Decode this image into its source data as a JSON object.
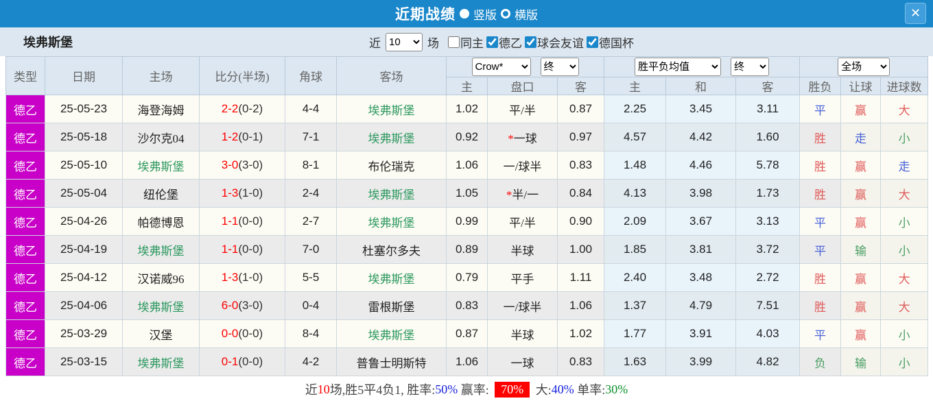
{
  "colors": {
    "accent_blue": "#1a87ca",
    "panel_bg": "#dce7f1",
    "badge_magenta": "#c800c8",
    "subject_team_green": "#2e9960",
    "score_red": "#ff0000",
    "win_red": "#e05c5c",
    "draw_blue": "#4a63d8",
    "lose_green": "#4a9e63",
    "euro_col_bg": "#e8f3fa"
  },
  "titlebar": {
    "title": "近期战绩",
    "radio_vertical": "竖版",
    "radio_horizontal": "横版",
    "close_glyph": "✕"
  },
  "filterbar": {
    "team": "埃弗斯堡",
    "near_label": "近",
    "matches_selected": "10",
    "matches_label": "场",
    "filters": [
      {
        "label": "同主",
        "checked": false
      },
      {
        "label": "德乙",
        "checked": true
      },
      {
        "label": "球会友谊",
        "checked": true
      },
      {
        "label": "德国杯",
        "checked": true
      }
    ]
  },
  "table": {
    "headers": {
      "type": "类型",
      "date": "日期",
      "home": "主场",
      "score": "比分(半场)",
      "corner": "角球",
      "away": "客场",
      "asian_select": "Crow*",
      "asian_final": "终",
      "asian_sub": [
        "主",
        "盘口",
        "客"
      ],
      "euro_select": "胜平负均值",
      "euro_final": "终",
      "euro_sub": [
        "主",
        "和",
        "客"
      ],
      "full_select": "全场",
      "result_sub": [
        "胜负",
        "让球",
        "进球数"
      ]
    },
    "rows": [
      {
        "league": "德乙",
        "date": "25-05-23",
        "home": "海登海姆",
        "home_is_subject": false,
        "score": "2-2",
        "half": "(0-2)",
        "corners": "4-4",
        "away": "埃弗斯堡",
        "away_is_subject": true,
        "asian": {
          "home": "1.02",
          "star": false,
          "handicap": "平/半",
          "away": "0.87"
        },
        "euro": {
          "home": "2.25",
          "draw": "3.45",
          "away": "3.11"
        },
        "outcome": {
          "text": "平",
          "color": "blue"
        },
        "handicap_result": {
          "text": "赢",
          "color": "red"
        },
        "goals_result": {
          "text": "大",
          "color": "red"
        }
      },
      {
        "league": "德乙",
        "date": "25-05-18",
        "home": "沙尔克04",
        "home_is_subject": false,
        "score": "1-2",
        "half": "(0-1)",
        "corners": "7-1",
        "away": "埃弗斯堡",
        "away_is_subject": true,
        "asian": {
          "home": "0.92",
          "star": true,
          "handicap": "一球",
          "away": "0.97"
        },
        "euro": {
          "home": "4.57",
          "draw": "4.42",
          "away": "1.60"
        },
        "outcome": {
          "text": "胜",
          "color": "red"
        },
        "handicap_result": {
          "text": "走",
          "color": "blue"
        },
        "goals_result": {
          "text": "小",
          "color": "green"
        }
      },
      {
        "league": "德乙",
        "date": "25-05-10",
        "home": "埃弗斯堡",
        "home_is_subject": true,
        "score": "3-0",
        "half": "(3-0)",
        "corners": "8-1",
        "away": "布伦瑞克",
        "away_is_subject": false,
        "asian": {
          "home": "1.06",
          "star": false,
          "handicap": "一/球半",
          "away": "0.83"
        },
        "euro": {
          "home": "1.48",
          "draw": "4.46",
          "away": "5.78"
        },
        "outcome": {
          "text": "胜",
          "color": "red"
        },
        "handicap_result": {
          "text": "赢",
          "color": "red"
        },
        "goals_result": {
          "text": "走",
          "color": "blue"
        }
      },
      {
        "league": "德乙",
        "date": "25-05-04",
        "home": "纽伦堡",
        "home_is_subject": false,
        "score": "1-3",
        "half": "(1-0)",
        "corners": "2-4",
        "away": "埃弗斯堡",
        "away_is_subject": true,
        "asian": {
          "home": "1.05",
          "star": true,
          "handicap": "半/一",
          "away": "0.84"
        },
        "euro": {
          "home": "4.13",
          "draw": "3.98",
          "away": "1.73"
        },
        "outcome": {
          "text": "胜",
          "color": "red"
        },
        "handicap_result": {
          "text": "赢",
          "color": "red"
        },
        "goals_result": {
          "text": "大",
          "color": "red"
        }
      },
      {
        "league": "德乙",
        "date": "25-04-26",
        "home": "帕德博恩",
        "home_is_subject": false,
        "score": "1-1",
        "half": "(0-0)",
        "corners": "2-7",
        "away": "埃弗斯堡",
        "away_is_subject": true,
        "asian": {
          "home": "0.99",
          "star": false,
          "handicap": "平/半",
          "away": "0.90"
        },
        "euro": {
          "home": "2.09",
          "draw": "3.67",
          "away": "3.13"
        },
        "outcome": {
          "text": "平",
          "color": "blue"
        },
        "handicap_result": {
          "text": "赢",
          "color": "red"
        },
        "goals_result": {
          "text": "小",
          "color": "green"
        }
      },
      {
        "league": "德乙",
        "date": "25-04-19",
        "home": "埃弗斯堡",
        "home_is_subject": true,
        "score": "1-1",
        "half": "(0-0)",
        "corners": "7-0",
        "away": "杜塞尔多夫",
        "away_is_subject": false,
        "asian": {
          "home": "0.89",
          "star": false,
          "handicap": "半球",
          "away": "1.00"
        },
        "euro": {
          "home": "1.85",
          "draw": "3.81",
          "away": "3.72"
        },
        "outcome": {
          "text": "平",
          "color": "blue"
        },
        "handicap_result": {
          "text": "输",
          "color": "green"
        },
        "goals_result": {
          "text": "小",
          "color": "green"
        }
      },
      {
        "league": "德乙",
        "date": "25-04-12",
        "home": "汉诺威96",
        "home_is_subject": false,
        "score": "1-3",
        "half": "(1-0)",
        "corners": "5-5",
        "away": "埃弗斯堡",
        "away_is_subject": true,
        "asian": {
          "home": "0.79",
          "star": false,
          "handicap": "平手",
          "away": "1.11"
        },
        "euro": {
          "home": "2.40",
          "draw": "3.48",
          "away": "2.72"
        },
        "outcome": {
          "text": "胜",
          "color": "red"
        },
        "handicap_result": {
          "text": "赢",
          "color": "red"
        },
        "goals_result": {
          "text": "大",
          "color": "red"
        }
      },
      {
        "league": "德乙",
        "date": "25-04-06",
        "home": "埃弗斯堡",
        "home_is_subject": true,
        "score": "6-0",
        "half": "(3-0)",
        "corners": "0-4",
        "away": "雷根斯堡",
        "away_is_subject": false,
        "asian": {
          "home": "0.83",
          "star": false,
          "handicap": "一/球半",
          "away": "1.06"
        },
        "euro": {
          "home": "1.37",
          "draw": "4.79",
          "away": "7.51"
        },
        "outcome": {
          "text": "胜",
          "color": "red"
        },
        "handicap_result": {
          "text": "赢",
          "color": "red"
        },
        "goals_result": {
          "text": "大",
          "color": "red"
        }
      },
      {
        "league": "德乙",
        "date": "25-03-29",
        "home": "汉堡",
        "home_is_subject": false,
        "score": "0-0",
        "half": "(0-0)",
        "corners": "8-4",
        "away": "埃弗斯堡",
        "away_is_subject": true,
        "asian": {
          "home": "0.87",
          "star": false,
          "handicap": "半球",
          "away": "1.02"
        },
        "euro": {
          "home": "1.77",
          "draw": "3.91",
          "away": "4.03"
        },
        "outcome": {
          "text": "平",
          "color": "blue"
        },
        "handicap_result": {
          "text": "赢",
          "color": "red"
        },
        "goals_result": {
          "text": "小",
          "color": "green"
        }
      },
      {
        "league": "德乙",
        "date": "25-03-15",
        "home": "埃弗斯堡",
        "home_is_subject": true,
        "score": "0-1",
        "half": "(0-0)",
        "corners": "4-2",
        "away": "普鲁士明斯特",
        "away_is_subject": false,
        "asian": {
          "home": "1.06",
          "star": false,
          "handicap": "一球",
          "away": "0.83"
        },
        "euro": {
          "home": "1.63",
          "draw": "3.99",
          "away": "4.82"
        },
        "outcome": {
          "text": "负",
          "color": "green"
        },
        "handicap_result": {
          "text": "输",
          "color": "green"
        },
        "goals_result": {
          "text": "小",
          "color": "green"
        }
      }
    ]
  },
  "summary": {
    "segments": [
      {
        "text": "近",
        "style": "black"
      },
      {
        "text": "10",
        "style": "red"
      },
      {
        "text": "场,胜5平4负1, 胜率:",
        "style": "black"
      },
      {
        "text": "50%",
        "style": "blue"
      },
      {
        "text": " 赢率: ",
        "style": "black"
      },
      {
        "text": "70%",
        "style": "redbox"
      },
      {
        "text": " 大:",
        "style": "black"
      },
      {
        "text": "40%",
        "style": "blue"
      },
      {
        "text": " 单率:",
        "style": "black"
      },
      {
        "text": "30%",
        "style": "green"
      }
    ]
  }
}
